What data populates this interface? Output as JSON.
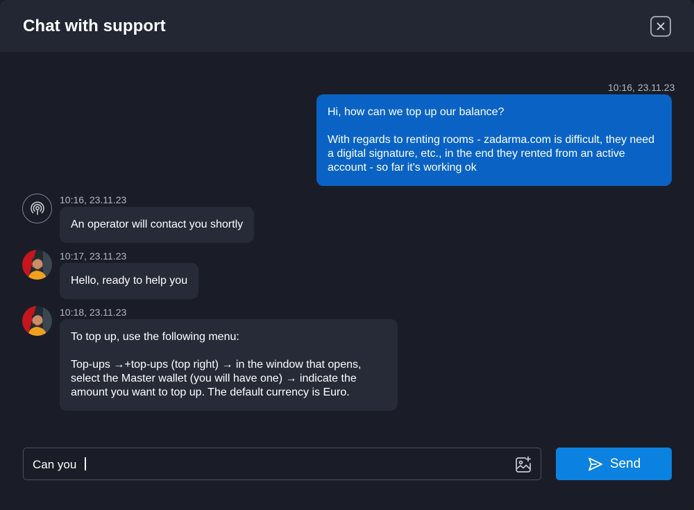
{
  "header": {
    "title": "Chat with support",
    "close_icon": "close-icon"
  },
  "messages": [
    {
      "direction": "outgoing",
      "timestamp": "10:16, 23.11.23",
      "paragraphs": [
        "Hi, how can we top up our balance?",
        "With regards to renting rooms - zadarma.com is difficult, they need a digital signature, etc., in the end they rented from an active account - so far it's working ok"
      ]
    },
    {
      "direction": "incoming",
      "sender": "bot",
      "avatar_icon": "bot-broadcast-icon",
      "timestamp": "10:16, 23.11.23",
      "paragraphs": [
        "An operator will contact you shortly"
      ]
    },
    {
      "direction": "incoming",
      "sender": "operator",
      "avatar_icon": "operator-avatar",
      "timestamp": "10:17, 23.11.23",
      "paragraphs": [
        "Hello, ready to help you"
      ]
    },
    {
      "direction": "incoming",
      "sender": "operator",
      "avatar_icon": "operator-avatar",
      "timestamp": "10:18, 23.11.23",
      "paragraphs": [
        "To top up, use the following menu:",
        "Top-ups →+top-ups (top right) → in the window that opens, select the Master wallet (you will have one) → indicate the amount you want to top up. The default currency is Euro."
      ]
    }
  ],
  "composer": {
    "value": "Can you ",
    "attach_icon": "image-add-icon",
    "send_label": "Send",
    "send_icon": "send-icon"
  },
  "colors": {
    "background": "#1a1d27",
    "header": "#232734",
    "outgoing_bubble": "#0a63c4",
    "incoming_bubble": "#272b38",
    "send_button": "#0b82e0"
  }
}
